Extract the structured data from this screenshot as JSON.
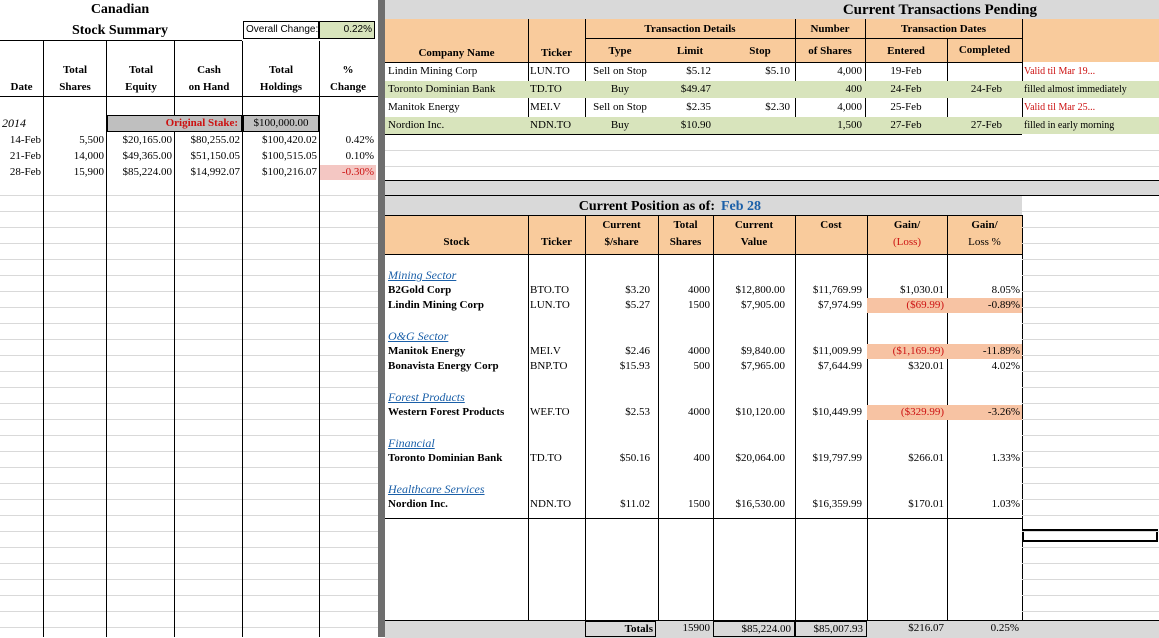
{
  "left": {
    "title1": "Canadian",
    "title2": "Stock Summary",
    "overall_label": "Overall Change:",
    "overall_value": "0.22%",
    "headers": {
      "date": "Date",
      "total_shares": [
        "Total",
        "Shares"
      ],
      "total_equity": [
        "Total",
        "Equity"
      ],
      "cash": [
        "Cash",
        "on Hand"
      ],
      "holdings": [
        "Total",
        "Holdings"
      ],
      "pct": [
        "%",
        "Change"
      ]
    },
    "year": "2014",
    "stake_label": "Original Stake:",
    "stake_value": "$100,000.00",
    "rows": [
      {
        "date": "14-Feb",
        "shares": "5,500",
        "equity": "$20,165.00",
        "cash": "$80,255.02",
        "holdings": "$100,420.02",
        "pct": "0.42%"
      },
      {
        "date": "21-Feb",
        "shares": "14,000",
        "equity": "$49,365.00",
        "cash": "$51,150.05",
        "holdings": "$100,515.05",
        "pct": "0.10%"
      },
      {
        "date": "28-Feb",
        "shares": "15,900",
        "equity": "$85,224.00",
        "cash": "$14,992.07",
        "holdings": "$100,216.07",
        "pct": "-0.30%"
      }
    ]
  },
  "pending": {
    "title": "Current Transactions Pending",
    "group_details": "Transaction Details",
    "group_number": "Number",
    "group_dates": "Transaction Dates",
    "headers": {
      "company": "Company Name",
      "ticker": "Ticker",
      "type": "Type",
      "limit": "Limit",
      "stop": "Stop",
      "shares": "of Shares",
      "entered": "Entered",
      "completed": "Completed"
    },
    "rows": [
      {
        "company": "Lindin Mining Corp",
        "ticker": "LUN.TO",
        "type": "Sell on Stop",
        "limit": "$5.12",
        "stop": "$5.10",
        "shares": "4,000",
        "entered": "19-Feb",
        "completed": "",
        "note": "Valid til Mar 19..."
      },
      {
        "company": "Toronto Dominian Bank",
        "ticker": "TD.TO",
        "type": "Buy",
        "limit": "$49.47",
        "stop": "",
        "shares": "400",
        "entered": "24-Feb",
        "completed": "24-Feb",
        "note": "filled almost immediately"
      },
      {
        "company": "Manitok Energy",
        "ticker": "MEI.V",
        "type": "Sell on Stop",
        "limit": "$2.35",
        "stop": "$2.30",
        "shares": "4,000",
        "entered": "25-Feb",
        "completed": "",
        "note": "Valid til Mar 25..."
      },
      {
        "company": "Nordion Inc.",
        "ticker": "NDN.TO",
        "type": "Buy",
        "limit": "$10.90",
        "stop": "",
        "shares": "1,500",
        "entered": "27-Feb",
        "completed": "27-Feb",
        "note": "filled in early morning"
      }
    ]
  },
  "position": {
    "title": "Current Position as of:",
    "date": "Feb 28",
    "headers": {
      "stock": "Stock",
      "ticker": "Ticker",
      "price": [
        "Current",
        "$/share"
      ],
      "shares": [
        "Total",
        "Shares"
      ],
      "value": [
        "Current",
        "Value"
      ],
      "cost": "Cost",
      "gain": [
        "Gain/",
        "(Loss)"
      ],
      "gainpct": [
        "Gain/",
        "Loss %"
      ]
    },
    "sectors": [
      {
        "name": "Mining Sector",
        "stocks": [
          {
            "stock": "B2Gold Corp",
            "ticker": "BTO.TO",
            "price": "$3.20",
            "shares": "4000",
            "value": "$12,800.00",
            "cost": "$11,769.99",
            "gain": "$1,030.01",
            "pct": "8.05%",
            "loss": false
          },
          {
            "stock": "Lindin Mining Corp",
            "ticker": "LUN.TO",
            "price": "$5.27",
            "shares": "1500",
            "value": "$7,905.00",
            "cost": "$7,974.99",
            "gain": "($69.99)",
            "pct": "-0.89%",
            "loss": true
          }
        ]
      },
      {
        "name": "O&G Sector",
        "stocks": [
          {
            "stock": "Manitok Energy",
            "ticker": "MEI.V",
            "price": "$2.46",
            "shares": "4000",
            "value": "$9,840.00",
            "cost": "$11,009.99",
            "gain": "($1,169.99)",
            "pct": "-11.89%",
            "loss": true
          },
          {
            "stock": "Bonavista Energy Corp",
            "ticker": "BNP.TO",
            "price": "$15.93",
            "shares": "500",
            "value": "$7,965.00",
            "cost": "$7,644.99",
            "gain": "$320.01",
            "pct": "4.02%",
            "loss": false
          }
        ]
      },
      {
        "name": "Forest Products",
        "stocks": [
          {
            "stock": "Western Forest Products",
            "ticker": "WEF.TO",
            "price": "$2.53",
            "shares": "4000",
            "value": "$10,120.00",
            "cost": "$10,449.99",
            "gain": "($329.99)",
            "pct": "-3.26%",
            "loss": true
          }
        ]
      },
      {
        "name": "Financial",
        "stocks": [
          {
            "stock": "Toronto Dominian Bank",
            "ticker": "TD.TO",
            "price": "$50.16",
            "shares": "400",
            "value": "$20,064.00",
            "cost": "$19,797.99",
            "gain": "$266.01",
            "pct": "1.33%",
            "loss": false
          }
        ]
      },
      {
        "name": "Healthcare Services",
        "stocks": [
          {
            "stock": "Nordion Inc.",
            "ticker": "NDN.TO",
            "price": "$11.02",
            "shares": "1500",
            "value": "$16,530.00",
            "cost": "$16,359.99",
            "gain": "$170.01",
            "pct": "1.03%",
            "loss": false
          }
        ]
      }
    ],
    "totals": {
      "label": "Totals",
      "shares": "15900",
      "value": "$85,224.00",
      "cost": "$85,007.93",
      "gain": "$216.07",
      "pct": "0.25%"
    }
  },
  "colors": {
    "header": "#f9cb9c",
    "green": "#d8e4bc",
    "gray": "#bfbfbf",
    "loss": "#f7c3a3",
    "pink": "#f4c7c3",
    "blue": "#1a5fa8",
    "red": "#cc1111"
  }
}
